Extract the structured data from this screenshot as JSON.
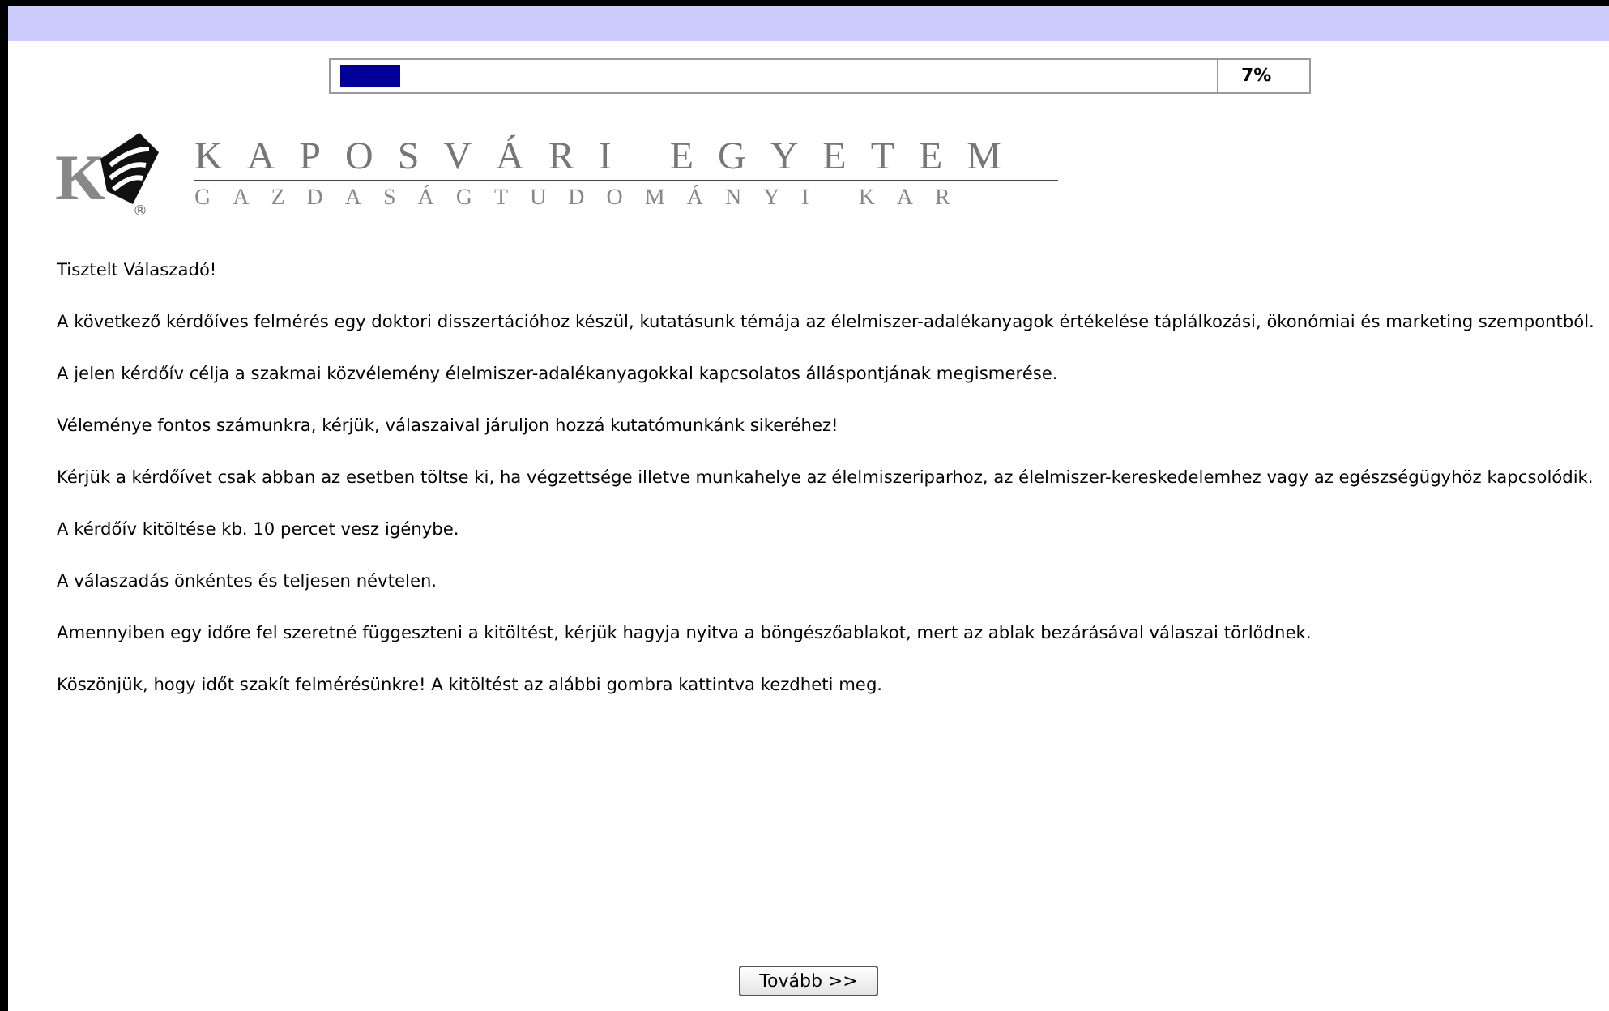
{
  "progress": {
    "level": 0.07,
    "reading": "7%"
  },
  "logo": {
    "letter": "K",
    "mark": "®",
    "title": "KAPOSVÁRI EGYETEM",
    "subtitle": "GAZDASÁGTUDOMÁNYI KAR"
  },
  "paragraphs": [
    "Tisztelt Válaszadó!",
    "A következő kérdőíves felmérés egy doktori disszertációhoz készül, kutatásunk témája az élelmiszer-adalékanyagok értékelése táplálkozási, ökonómiai és marketing szempontból.",
    "A jelen kérdőív célja a szakmai közvélemény élelmiszer-adalékanyagokkal kapcsolatos álláspontjának megismerése.",
    "Véleménye fontos számunkra, kérjük, válaszaival járuljon hozzá kutatómunkánk sikeréhez!",
    "Kérjük a kérdőívet csak abban az esetben töltse ki, ha végzettsége illetve munkahelye az élelmiszeriparhoz, az élelmiszer-kereskedelemhez vagy az egészségügyhöz kapcsolódik.",
    "A kérdőív kitöltése kb. 10 percet vesz igénybe.",
    "A válaszadás önkéntes és teljesen névtelen.",
    "Amennyiben egy időre fel szeretné függeszteni a kitöltést, kérjük hagyja nyitva a böngészőablakot, mert az ablak bezárásával válaszai törlődnek.",
    "Köszönjük, hogy időt szakít felmérésünkre! A kitöltést az alábbi gombra kattintva kezdheti meg."
  ],
  "next_button": "Tovább >>"
}
